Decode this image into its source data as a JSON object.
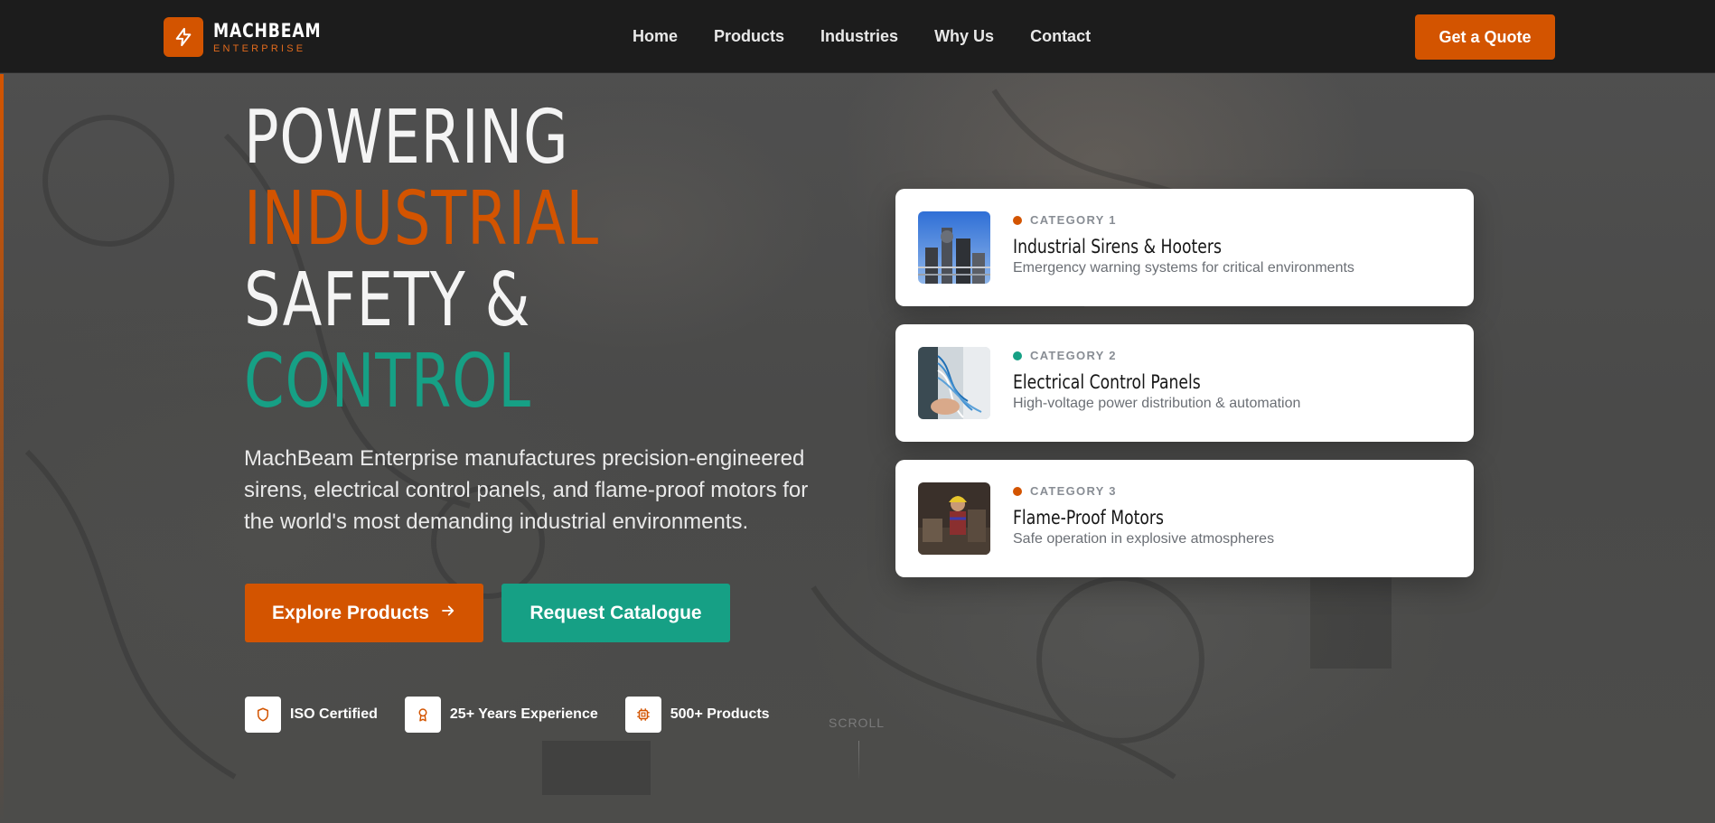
{
  "brand": {
    "name": "MACHBEAM",
    "subtitle": "ENTERPRISE"
  },
  "nav": {
    "items": [
      {
        "label": "Home"
      },
      {
        "label": "Products"
      },
      {
        "label": "Industries"
      },
      {
        "label": "Why Us"
      },
      {
        "label": "Contact"
      }
    ]
  },
  "header": {
    "cta_label": "Get a Quote"
  },
  "hero": {
    "headline": [
      "POWERING",
      "INDUSTRIAL",
      "SAFETY &",
      "CONTROL"
    ],
    "description": "MachBeam Enterprise manufactures precision-engineered sirens, electrical control panels, and flame-proof motors for the world's most demanding industrial environments.",
    "primary_button": "Explore Products",
    "secondary_button": "Request Catalogue",
    "badges": [
      {
        "label": "ISO Certified",
        "icon": "shield-icon"
      },
      {
        "label": "25+ Years Experience",
        "icon": "award-icon"
      },
      {
        "label": "500+ Products",
        "icon": "cpu-chip-icon"
      }
    ],
    "scroll_label": "SCROLL"
  },
  "categories": [
    {
      "category": "CATEGORY 1",
      "title": "Industrial Sirens & Hooters",
      "description": "Emergency warning systems for critical environments",
      "dot_color": "#d35400",
      "image": "industrial-plant-photo"
    },
    {
      "category": "CATEGORY 2",
      "title": "Electrical Control Panels",
      "description": "High-voltage power distribution & automation",
      "dot_color": "#16a085",
      "image": "control-panel-wiring-photo"
    },
    {
      "category": "CATEGORY 3",
      "title": "Flame-Proof Motors",
      "description": "Safe operation in explosive atmospheres",
      "dot_color": "#d35400",
      "image": "worker-with-hardhat-photo"
    }
  ],
  "colors": {
    "accent": "#d35400",
    "teal": "#16a085",
    "header_bg": "#1c1c1c"
  }
}
